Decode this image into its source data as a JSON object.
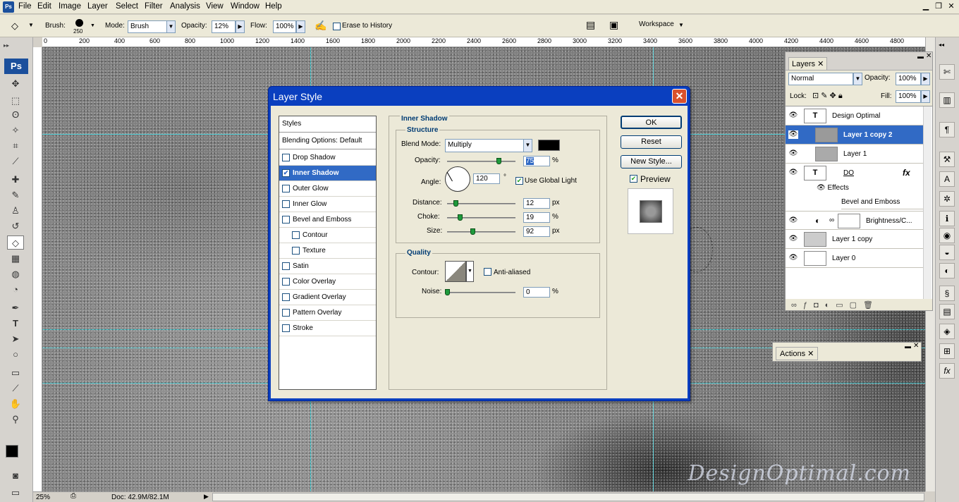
{
  "menubar": {
    "items": [
      "File",
      "Edit",
      "Image",
      "Layer",
      "Select",
      "Filter",
      "Analysis",
      "View",
      "Window",
      "Help"
    ],
    "app_icon": "Ps"
  },
  "options": {
    "brush_label": "Brush:",
    "brush_size": "250",
    "mode_label": "Mode:",
    "mode_value": "Brush",
    "opacity_label": "Opacity:",
    "opacity_value": "12%",
    "flow_label": "Flow:",
    "flow_value": "100%",
    "erase_history": "Erase to History",
    "workspace": "Workspace"
  },
  "ruler": {
    "marks": [
      "0",
      "200",
      "400",
      "600",
      "800",
      "1000",
      "1200",
      "1400",
      "1600",
      "1800",
      "2000",
      "2200",
      "2400",
      "2600",
      "2800",
      "3000",
      "3200",
      "3400",
      "3600",
      "3800",
      "4000",
      "4200",
      "4400",
      "4600",
      "4800"
    ]
  },
  "status": {
    "zoom": "25%",
    "doc": "Doc: 42.9M/82.1M"
  },
  "watermark": "DesignOptimal.com",
  "dialog": {
    "title": "Layer Style",
    "styles_header": "Styles",
    "blending": "Blending Options: Default",
    "items": [
      {
        "label": "Drop Shadow",
        "checked": false,
        "sub": false
      },
      {
        "label": "Inner Shadow",
        "checked": true,
        "sub": false,
        "selected": true
      },
      {
        "label": "Outer Glow",
        "checked": false,
        "sub": false
      },
      {
        "label": "Inner Glow",
        "checked": false,
        "sub": false
      },
      {
        "label": "Bevel and Emboss",
        "checked": false,
        "sub": false
      },
      {
        "label": "Contour",
        "checked": false,
        "sub": true
      },
      {
        "label": "Texture",
        "checked": false,
        "sub": true
      },
      {
        "label": "Satin",
        "checked": false,
        "sub": false
      },
      {
        "label": "Color Overlay",
        "checked": false,
        "sub": false
      },
      {
        "label": "Gradient Overlay",
        "checked": false,
        "sub": false
      },
      {
        "label": "Pattern Overlay",
        "checked": false,
        "sub": false
      },
      {
        "label": "Stroke",
        "checked": false,
        "sub": false
      }
    ],
    "section": "Inner Shadow",
    "structure": "Structure",
    "blend_mode_label": "Blend Mode:",
    "blend_mode": "Multiply",
    "opacity_label": "Opacity:",
    "opacity": "75",
    "opacity_pct": 0.75,
    "angle_label": "Angle:",
    "angle": "120",
    "use_global": "Use Global Light",
    "distance_label": "Distance:",
    "distance": "12",
    "distance_pct": 0.12,
    "choke_label": "Choke:",
    "choke": "19",
    "choke_pct": 0.19,
    "size_label": "Size:",
    "size": "92",
    "size_pct": 0.37,
    "quality": "Quality",
    "contour_label": "Contour:",
    "antialiased": "Anti-aliased",
    "noise_label": "Noise:",
    "noise": "0",
    "noise_pct": 0,
    "unit_pct": "%",
    "unit_px": "px",
    "unit_deg": "°",
    "buttons": {
      "ok": "OK",
      "reset": "Reset",
      "new_style": "New Style...",
      "preview": "Preview"
    }
  },
  "layers_panel": {
    "tab": "Layers",
    "blend": "Normal",
    "opacity_label": "Opacity:",
    "opacity": "100%",
    "lock_label": "Lock:",
    "fill_label": "Fill:",
    "fill": "100%",
    "layers": [
      {
        "name": "Design Optimal",
        "type": "text"
      },
      {
        "name": "Layer 1 copy 2",
        "type": "image",
        "selected": true
      },
      {
        "name": "Layer 1",
        "type": "image"
      },
      {
        "name": "DO",
        "type": "text"
      },
      {
        "name": "Effects",
        "type": "effects"
      },
      {
        "name": "Bevel and Emboss",
        "type": "effect"
      },
      {
        "name": "Brightness/C...",
        "type": "adjust"
      },
      {
        "name": "Layer 1 copy",
        "type": "image"
      },
      {
        "name": "Layer 0",
        "type": "image"
      }
    ]
  },
  "actions_panel": {
    "tab": "Actions"
  },
  "colors": {
    "dialog_title": "#0a3fbf",
    "selection": "#316ac5",
    "guide": "#4fd0d8"
  }
}
